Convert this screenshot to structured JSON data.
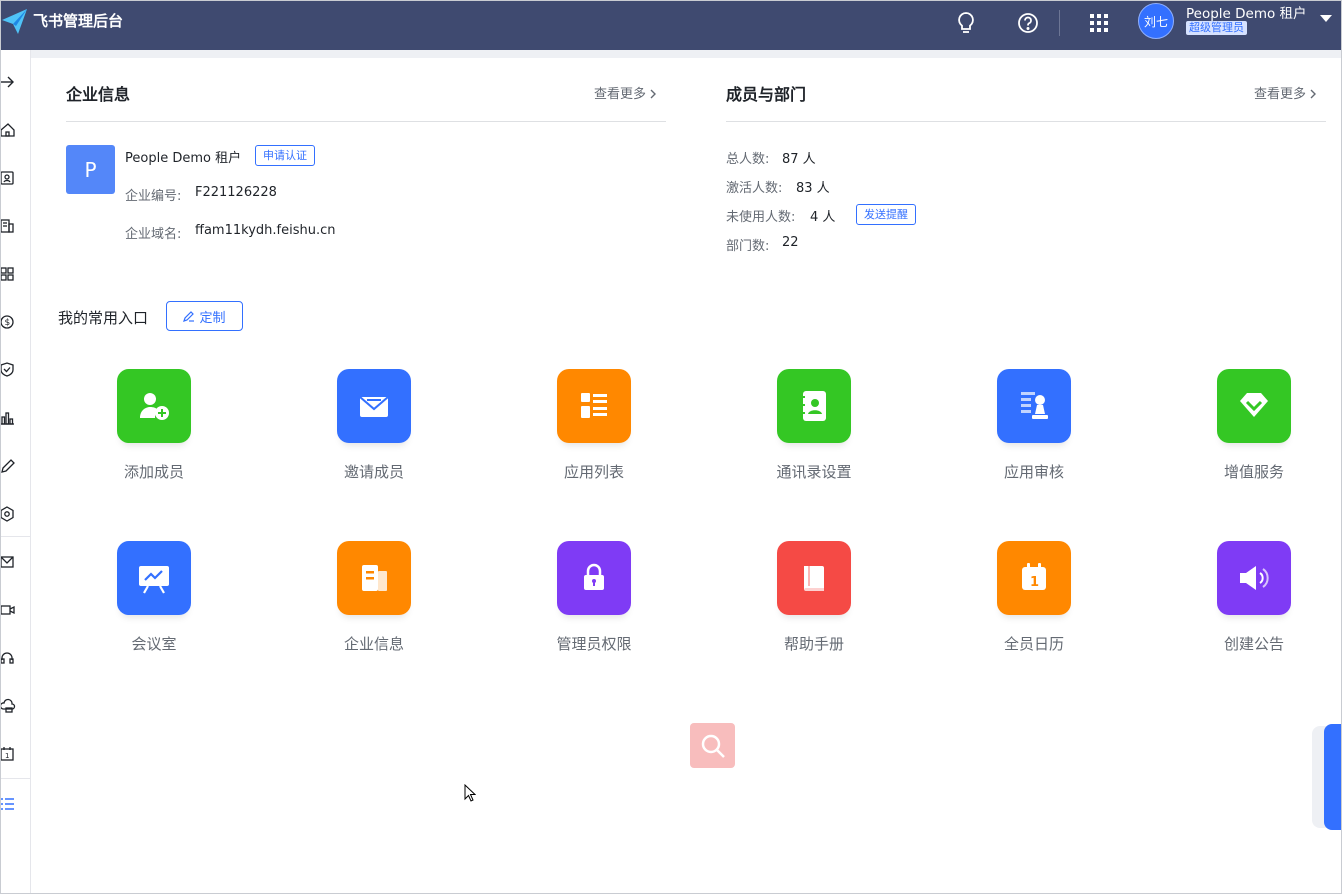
{
  "topbar": {
    "app_title": "飞书管理后台",
    "user_avatar_text": "刘七",
    "tenant_name": "People Demo 租户",
    "role": "超级管理员",
    "icons": [
      "lightbulb-icon",
      "help-icon",
      "app-grid-icon"
    ]
  },
  "sidebar": {
    "icons": [
      "collapse-arrow-icon",
      "home-icon",
      "contacts-icon",
      "building-icon",
      "apps-icon",
      "dollar-icon",
      "shield-icon",
      "chart-icon",
      "pen-icon",
      "settings-icon",
      "mail-icon",
      "video-icon",
      "headset-icon",
      "cloud-icon",
      "calendar-icon",
      "list-icon"
    ]
  },
  "enterprise": {
    "title": "企业信息",
    "more": "查看更多",
    "logo_letter": "P",
    "name": "People Demo 租户",
    "certify_button": "申请认证",
    "id_label": "企业编号:",
    "id_value": "F221126228",
    "domain_label": "企业域名:",
    "domain_value": "ffam11kydh.feishu.cn"
  },
  "members": {
    "title": "成员与部门",
    "more": "查看更多",
    "total_label": "总人数:",
    "total_value": "87 人",
    "active_label": "激活人数:",
    "active_value": "83 人",
    "unused_label": "未使用人数:",
    "unused_value": "4 人",
    "remind_button": "发送提醒",
    "dept_label": "部门数:",
    "dept_value": "22"
  },
  "shortcuts": {
    "title": "我的常用入口",
    "customize_button": "定制",
    "tiles": [
      {
        "label": "添加成员",
        "color": "#34c724",
        "icon": "add-member-icon"
      },
      {
        "label": "邀请成员",
        "color": "#3370ff",
        "icon": "invite-mail-icon"
      },
      {
        "label": "应用列表",
        "color": "#ff8800",
        "icon": "app-list-icon"
      },
      {
        "label": "通讯录设置",
        "color": "#34c724",
        "icon": "address-book-icon"
      },
      {
        "label": "应用审核",
        "color": "#3370ff",
        "icon": "app-review-icon"
      },
      {
        "label": "增值服务",
        "color": "#34c724",
        "icon": "diamond-icon"
      },
      {
        "label": "会议室",
        "color": "#3370ff",
        "icon": "meeting-room-icon"
      },
      {
        "label": "企业信息",
        "color": "#ff8800",
        "icon": "enterprise-info-icon"
      },
      {
        "label": "管理员权限",
        "color": "#7f3bf5",
        "icon": "lock-icon"
      },
      {
        "label": "帮助手册",
        "color": "#f54a45",
        "icon": "book-icon"
      },
      {
        "label": "全员日历",
        "color": "#ff8800",
        "icon": "calendar-icon"
      },
      {
        "label": "创建公告",
        "color": "#7f3bf5",
        "icon": "megaphone-icon"
      }
    ]
  }
}
